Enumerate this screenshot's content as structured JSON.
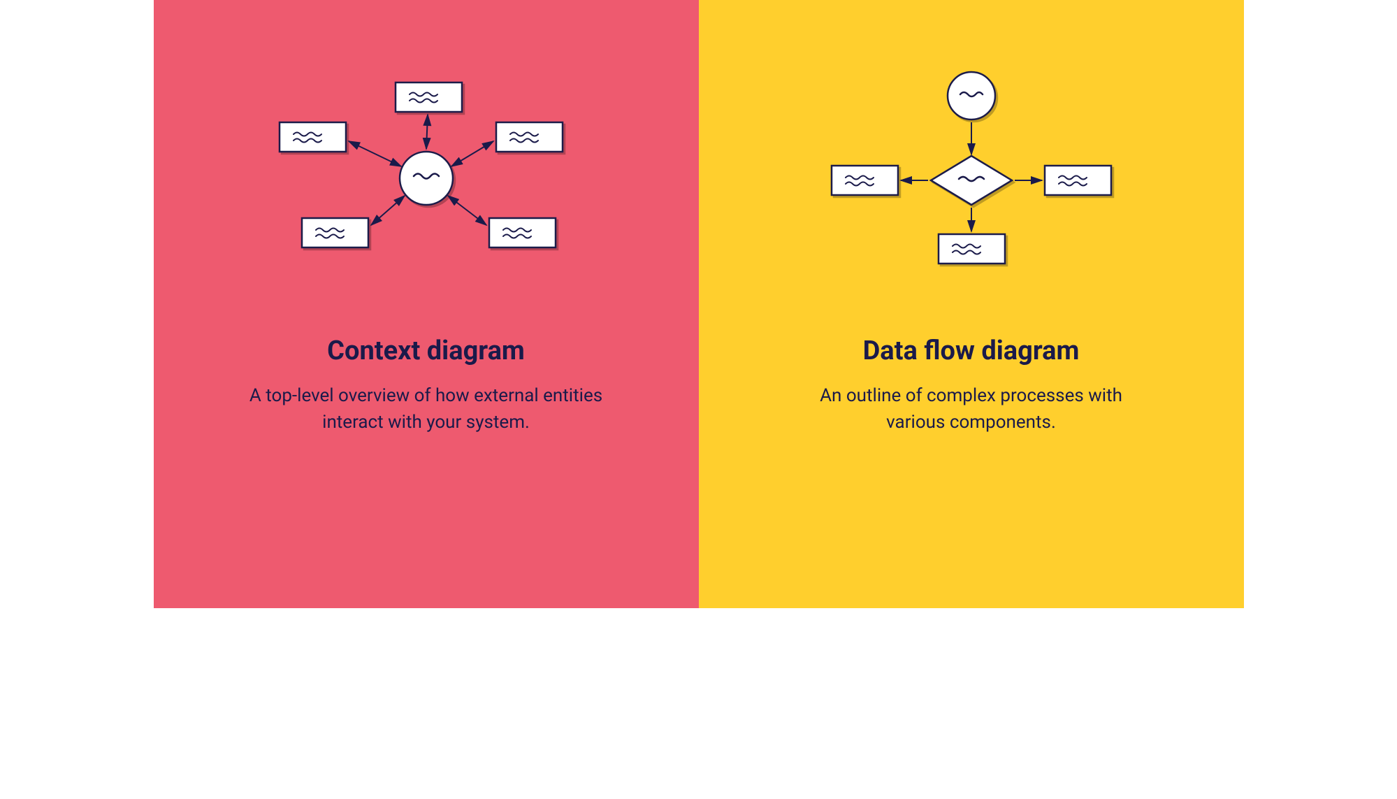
{
  "panels": {
    "left": {
      "title": "Context diagram",
      "description": "A top-level overview of how external entities interact with your system.",
      "bg_color": "#ee5a6f"
    },
    "right": {
      "title": "Data flow diagram",
      "description": "An outline of complex processes with various components.",
      "bg_color": "#ffcf2d"
    }
  },
  "diagram_colors": {
    "stroke": "#1a1a4a",
    "fill": "#ffffff",
    "shadow": "rgba(0,0,0,0.2)"
  }
}
